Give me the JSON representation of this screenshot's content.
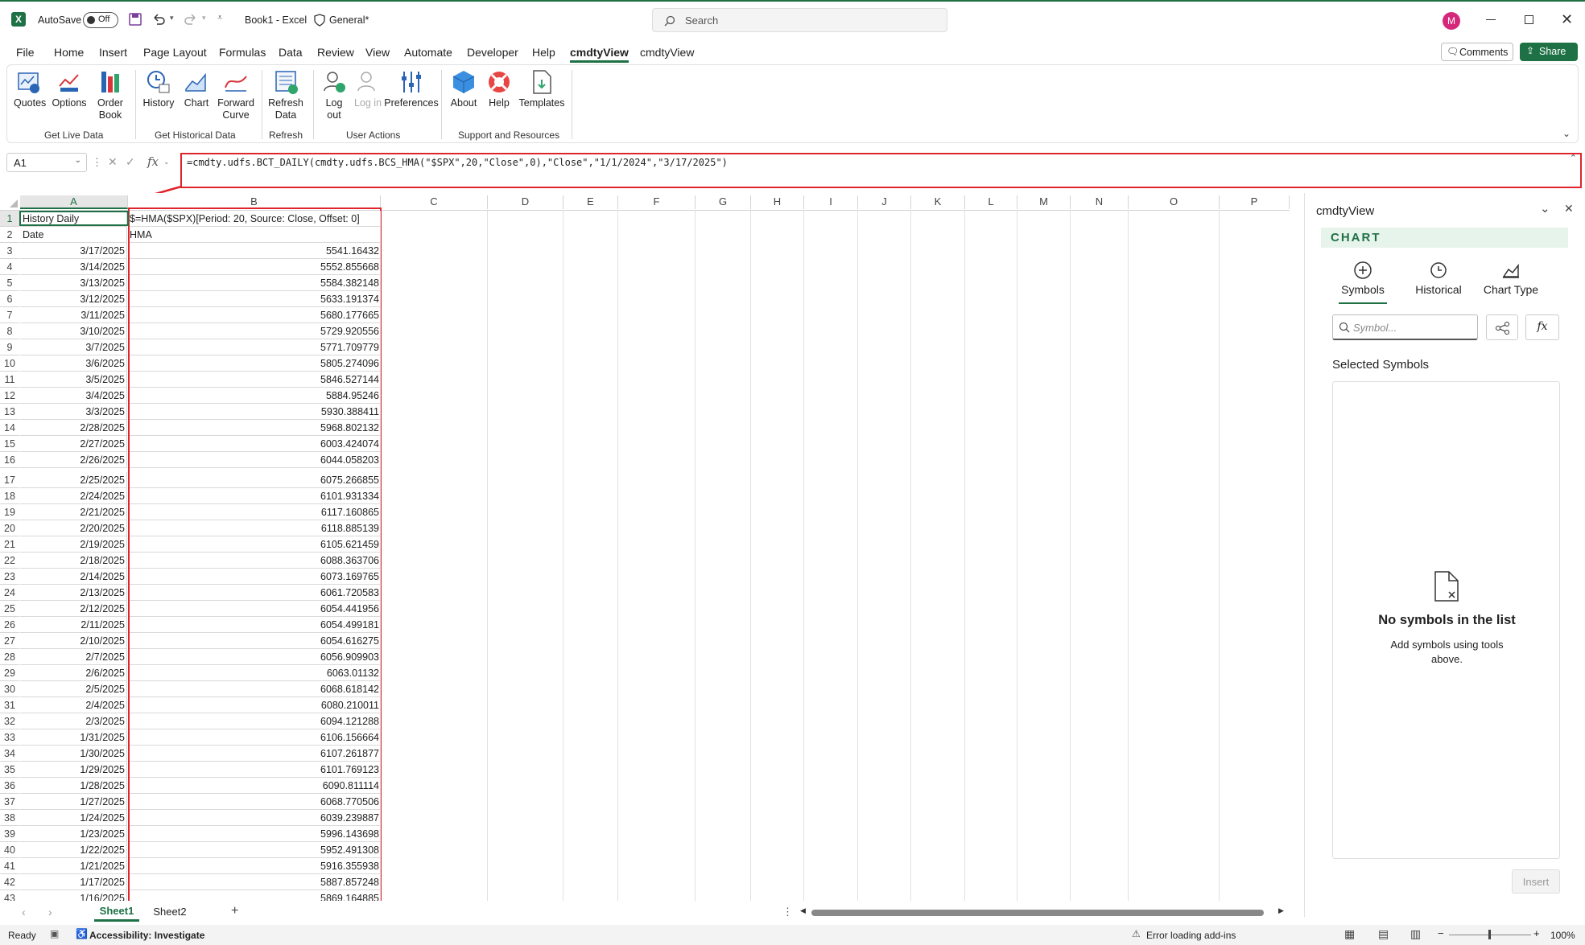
{
  "titlebar": {
    "autosave_label": "AutoSave",
    "autosave_state": "Off",
    "doc_title": "Book1 - Excel",
    "sensitivity": "General*",
    "search_placeholder": "Search",
    "avatar_initial": "M",
    "accent": "#1e7145",
    "avatar_color": "#d6287a"
  },
  "menu": {
    "items": [
      "File",
      "Home",
      "Insert",
      "Page Layout",
      "Formulas",
      "Data",
      "Review",
      "View",
      "Automate",
      "Developer",
      "Help",
      "cmdtyView",
      "cmdtyView"
    ],
    "active_index": 11,
    "comments_label": "Comments",
    "share_label": "Share"
  },
  "ribbon": {
    "buttons": {
      "quotes": "Quotes",
      "options": "Options",
      "order_book": "Order Book",
      "history": "History",
      "chart": "Chart",
      "forward_curve": "Forward Curve",
      "refresh_data": "Refresh Data",
      "log_out": "Log out",
      "log_in": "Log in",
      "preferences": "Preferences",
      "about": "About",
      "help": "Help",
      "templates": "Templates"
    },
    "groups": {
      "live": "Get Live Data",
      "historical": "Get Historical Data",
      "refresh": "Refresh",
      "user": "User Actions",
      "support": "Support and Resources"
    }
  },
  "formula_bar": {
    "name_box": "A1",
    "fx": "fx",
    "formula": "=cmdty.udfs.BCT_DAILY(cmdty.udfs.BCS_HMA(\"$SPX\",20,\"Close\",0),\"Close\",\"1/1/2024\",\"3/17/2025\")"
  },
  "sheet": {
    "columns": [
      "A",
      "B",
      "C",
      "D",
      "E",
      "F",
      "G",
      "H",
      "I",
      "J",
      "K",
      "L",
      "M",
      "N",
      "O",
      "P"
    ],
    "a1": "History Daily",
    "b1": "$=HMA($SPX)[Period: 20, Source: Close, Offset: 0]",
    "a2": "Date",
    "b2": "HMA",
    "rows": [
      {
        "n": "3",
        "date": "3/17/2025",
        "hma": "5541.16432"
      },
      {
        "n": "4",
        "date": "3/14/2025",
        "hma": "5552.855668"
      },
      {
        "n": "5",
        "date": "3/13/2025",
        "hma": "5584.382148"
      },
      {
        "n": "6",
        "date": "3/12/2025",
        "hma": "5633.191374"
      },
      {
        "n": "7",
        "date": "3/11/2025",
        "hma": "5680.177665"
      },
      {
        "n": "8",
        "date": "3/10/2025",
        "hma": "5729.920556"
      },
      {
        "n": "9",
        "date": "3/7/2025",
        "hma": "5771.709779"
      },
      {
        "n": "10",
        "date": "3/6/2025",
        "hma": "5805.274096"
      },
      {
        "n": "11",
        "date": "3/5/2025",
        "hma": "5846.527144"
      },
      {
        "n": "12",
        "date": "3/4/2025",
        "hma": "5884.95246"
      },
      {
        "n": "13",
        "date": "3/3/2025",
        "hma": "5930.388411"
      },
      {
        "n": "14",
        "date": "2/28/2025",
        "hma": "5968.802132"
      },
      {
        "n": "15",
        "date": "2/27/2025",
        "hma": "6003.424074"
      },
      {
        "n": "16",
        "date": "2/26/2025",
        "hma": "6044.058203"
      },
      {
        "n": "17",
        "date": "2/25/2025",
        "hma": "6075.266855"
      },
      {
        "n": "18",
        "date": "2/24/2025",
        "hma": "6101.931334"
      },
      {
        "n": "19",
        "date": "2/21/2025",
        "hma": "6117.160865"
      },
      {
        "n": "20",
        "date": "2/20/2025",
        "hma": "6118.885139"
      },
      {
        "n": "21",
        "date": "2/19/2025",
        "hma": "6105.621459"
      },
      {
        "n": "22",
        "date": "2/18/2025",
        "hma": "6088.363706"
      },
      {
        "n": "23",
        "date": "2/14/2025",
        "hma": "6073.169765"
      },
      {
        "n": "24",
        "date": "2/13/2025",
        "hma": "6061.720583"
      },
      {
        "n": "25",
        "date": "2/12/2025",
        "hma": "6054.441956"
      },
      {
        "n": "26",
        "date": "2/11/2025",
        "hma": "6054.499181"
      },
      {
        "n": "27",
        "date": "2/10/2025",
        "hma": "6054.616275"
      },
      {
        "n": "28",
        "date": "2/7/2025",
        "hma": "6056.909903"
      },
      {
        "n": "29",
        "date": "2/6/2025",
        "hma": "6063.01132"
      },
      {
        "n": "30",
        "date": "2/5/2025",
        "hma": "6068.618142"
      },
      {
        "n": "31",
        "date": "2/4/2025",
        "hma": "6080.210011"
      },
      {
        "n": "32",
        "date": "2/3/2025",
        "hma": "6094.121288"
      },
      {
        "n": "33",
        "date": "1/31/2025",
        "hma": "6106.156664"
      },
      {
        "n": "34",
        "date": "1/30/2025",
        "hma": "6107.261877"
      },
      {
        "n": "35",
        "date": "1/29/2025",
        "hma": "6101.769123"
      },
      {
        "n": "36",
        "date": "1/28/2025",
        "hma": "6090.811114"
      },
      {
        "n": "37",
        "date": "1/27/2025",
        "hma": "6068.770506"
      },
      {
        "n": "38",
        "date": "1/24/2025",
        "hma": "6039.239887"
      },
      {
        "n": "39",
        "date": "1/23/2025",
        "hma": "5996.143698"
      },
      {
        "n": "40",
        "date": "1/22/2025",
        "hma": "5952.491308"
      },
      {
        "n": "41",
        "date": "1/21/2025",
        "hma": "5916.355938"
      },
      {
        "n": "42",
        "date": "1/17/2025",
        "hma": "5887.857248"
      },
      {
        "n": "43",
        "date": "1/16/2025",
        "hma": "5869.164885"
      }
    ],
    "tabs": [
      "Sheet1",
      "Sheet2"
    ],
    "add_tab": "+"
  },
  "panel": {
    "title": "cmdtyView",
    "section": "CHART",
    "tabs": [
      "Symbols",
      "Historical",
      "Chart Type"
    ],
    "symbol_placeholder": "Symbol...",
    "fx": "fx",
    "selected_heading": "Selected Symbols",
    "empty_title": "No symbols in the list",
    "empty_sub": "Add symbols using tools above.",
    "insert_label": "Insert"
  },
  "status": {
    "ready": "Ready",
    "accessibility": "Accessibility: Investigate",
    "addins_error": "Error loading add-ins",
    "zoom_minus": "−",
    "zoom_plus": "+",
    "zoom": "100%"
  },
  "highlight_color": "#e0242b"
}
